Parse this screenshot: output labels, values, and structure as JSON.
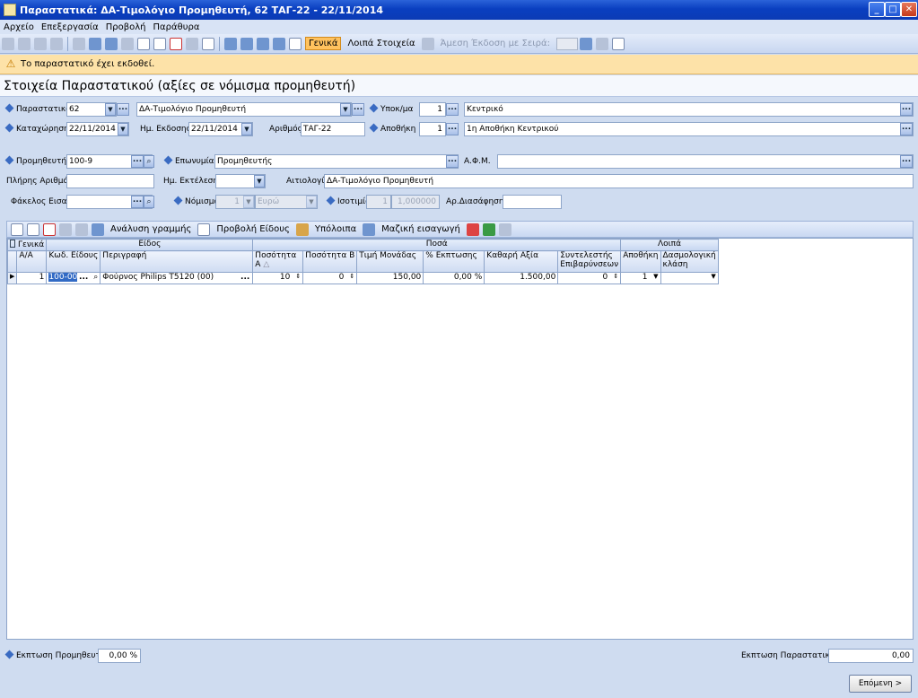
{
  "window": {
    "title": "Παραστατικά: ΔΑ-Τιμολόγιο Προμηθευτή, 62 ΤΑΓ-22 - 22/11/2014"
  },
  "menu": [
    "Αρχείο",
    "Επεξεργασία",
    "Προβολή",
    "Παράθυρα"
  ],
  "toolbar": {
    "tab_general": "Γενικά",
    "tab_other": "Λοιπά Στοιχεία",
    "direct_issue": "Άμεση Έκδοση με Σειρά:"
  },
  "warning": "Το παραστατικό έχει εκδοθεί.",
  "section_title": "Στοιχεία Παραστατικού (αξίες σε νόμισμα προμηθευτή)",
  "form": {
    "doc_label": "Παραστατικό",
    "doc_code": "62",
    "doc_name": "ΔΑ-Τιμολόγιο Προμηθευτή",
    "branch_label": "Υποκ/μα",
    "branch_code": "1",
    "branch_name": "Κεντρικό",
    "reg_label": "Καταχώρηση",
    "reg_date": "22/11/2014",
    "issue_label": "Ημ. Εκδοσης",
    "issue_date": "22/11/2014",
    "number_label": "Αριθμός",
    "number_value": "ΤΑΓ-22",
    "warehouse_label": "Αποθήκη",
    "warehouse_code": "1",
    "warehouse_name": "1η Αποθήκη Κεντρικού",
    "supplier_label": "Προμηθευτής",
    "supplier_code": "100-9",
    "name_label": "Επωνυμία",
    "name_value": "Προμηθευτής",
    "afm_label": "Α.Φ.Μ.",
    "afm_value": "",
    "fullnum_label": "Πλήρης Αριθμός",
    "fullnum_value": "",
    "exec_label": "Ημ. Εκτέλεσης",
    "exec_value": "",
    "reason_label": "Αιτιολογία",
    "reason_value": "ΔΑ-Τιμολόγιο Προμηθευτή",
    "folder_label": "Φάκελος Εισαγ",
    "folder_value": "",
    "currency_label": "Νόμισμα",
    "currency_code": "1",
    "currency_name": "Ευρώ",
    "parity_label": "Ισοτιμία",
    "parity_code": "1",
    "parity_value": "1,000000",
    "clearance_label": "Αρ.Διασάφησης",
    "clearance_value": ""
  },
  "grid_toolbar": {
    "analysis": "Ανάλυση γραμμής",
    "view_item": "Προβολή Είδους",
    "remaining": "Υπόλοιπα",
    "bulk_import": "Μαζική εισαγωγή"
  },
  "grid": {
    "bands": [
      "Γενικά",
      "Είδος",
      "Ποσά",
      "Λοιπά"
    ],
    "headers": [
      "Α/Α",
      "Κωδ. Είδους",
      "Περιγραφή",
      "Ποσότητα Α",
      "Ποσότητα Β",
      "Τιμή Μονάδας",
      "% Εκπτωσης",
      "Καθαρή Αξία",
      "Συντελεστής Επιβαρύνσεων",
      "Αποθήκη",
      "Δασμολογική κλάση"
    ],
    "rows": [
      {
        "aa": "1",
        "code": "100-00",
        "desc": "Φούρνος Philips T5120 (00)",
        "qa": "10",
        "qb": "0",
        "price": "150,00",
        "disc": "0,00 %",
        "net": "1.500,00",
        "coef": "0",
        "wh": "1",
        "tariff": ""
      }
    ]
  },
  "footer": {
    "supp_disc_label": "Εκπτωση Προμηθευτή",
    "supp_disc_value": "0,00 %",
    "doc_disc_label": "Εκπτωση Παραστατικού",
    "doc_disc_value": "0,00",
    "next_button": "Επόμενη >"
  }
}
